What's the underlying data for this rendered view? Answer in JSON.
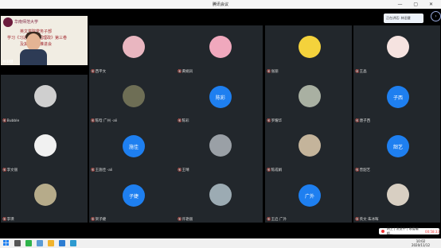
{
  "window": {
    "title": "腾讯会议"
  },
  "share": {
    "logo_text": "华南师范大学",
    "line1": "英文学院党务子部",
    "line2": "学习《习近平谈治国理政》第三卷",
    "line3": "及其它工作推进会",
    "speaker": "林旧健"
  },
  "tiles": [
    {
      "name": "西平文",
      "kind": "avatar",
      "color": "#e9b6c0"
    },
    {
      "name": "黄娟凤",
      "kind": "avatar",
      "color": "#f0a8bd"
    },
    {
      "name": "张丽",
      "kind": "avatar",
      "color": "#f4d23c"
    },
    {
      "name": "王晶",
      "kind": "avatar",
      "color": "#f6e3e0"
    },
    {
      "name": "Bubble",
      "kind": "avatar",
      "color": "#cfcfcf"
    },
    {
      "name": "陈晗 广州 -ali",
      "kind": "avatar",
      "color": "#6e6e55"
    },
    {
      "name": "陈彩",
      "kind": "initial",
      "initial": "陈彩"
    },
    {
      "name": "罗耀华",
      "kind": "avatar",
      "color": "#a9b0a2"
    },
    {
      "name": "唐子西",
      "kind": "initial",
      "initial": "子西"
    },
    {
      "name": "李文丽",
      "kind": "avatar",
      "color": "#f1f1f1"
    },
    {
      "name": "王施佳 -ali",
      "kind": "initial",
      "initial": "施佳"
    },
    {
      "name": "王晴",
      "kind": "avatar",
      "color": "#9aa0a6"
    },
    {
      "name": "陈成娟",
      "kind": "avatar",
      "color": "#c4b49b"
    },
    {
      "name": "曾韶艺",
      "kind": "initial",
      "initial": "韶艺"
    },
    {
      "name": "李瑛",
      "kind": "avatar",
      "color": "#b6ab8a"
    },
    {
      "name": "贺子婕",
      "kind": "initial",
      "initial": "子婕"
    },
    {
      "name": "许艳丽",
      "kind": "avatar",
      "color": "#9cabb3"
    },
    {
      "name": "王启 广外",
      "kind": "initial",
      "initial": "广外"
    },
    {
      "name": "英文 朱冰晖",
      "kind": "avatar",
      "color": "#d8cfc2"
    }
  ],
  "right_panel": {
    "label": "正在讲话: 林旧健"
  },
  "badge": {
    "text": "网上 | 发送中 | 收看编辑...",
    "count": "00:58:33"
  },
  "taskbar": {
    "time": "10:02",
    "date": "2020/11/12"
  }
}
